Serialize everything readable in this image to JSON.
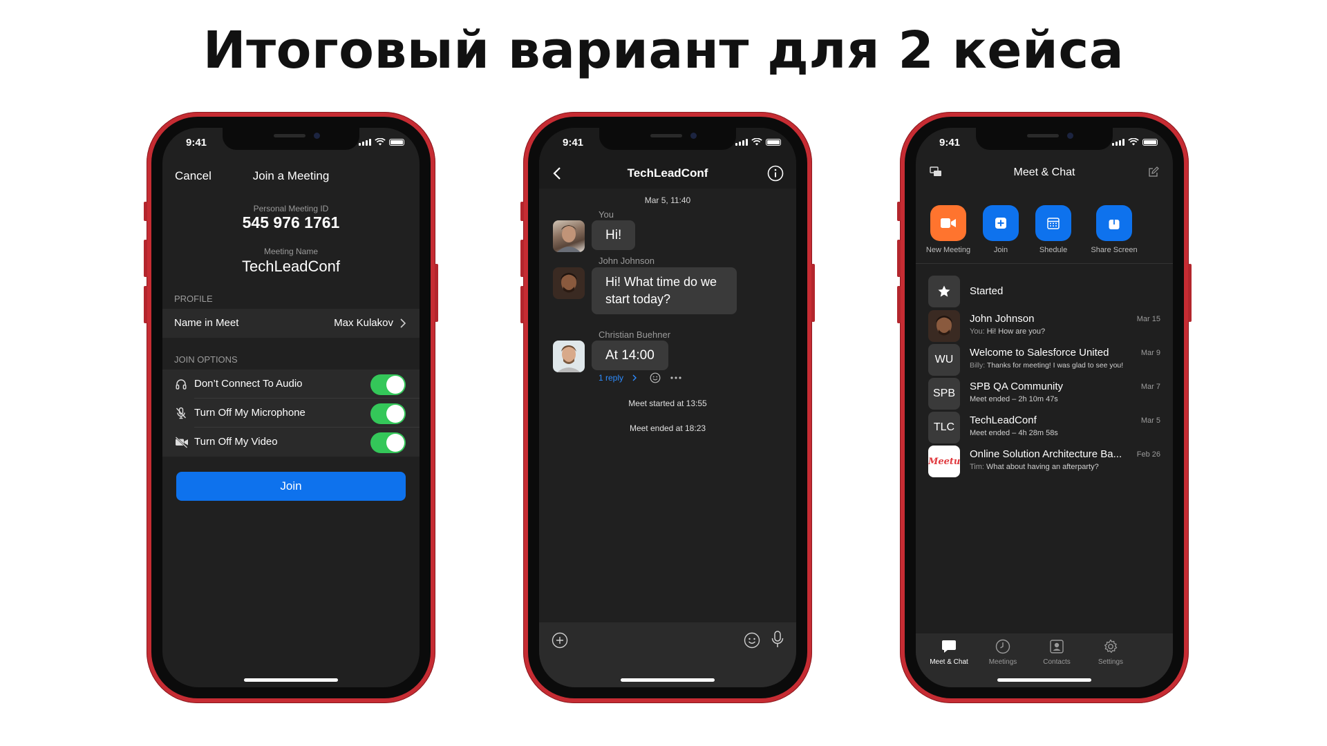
{
  "slide_title": "Итоговый вариант для 2 кейса",
  "status_time": "9:41",
  "join_screen": {
    "cancel": "Cancel",
    "title": "Join a Meeting",
    "pmi_label": "Personal Meeting ID",
    "pmi_value": "545 976 1761",
    "meeting_name_label": "Meeting Name",
    "meeting_name_value": "TechLeadConf",
    "profile_header": "PROFILE",
    "name_in_meet_label": "Name in Meet",
    "name_in_meet_value": "Max Kulakov",
    "join_options_header": "JOIN OPTIONS",
    "options": [
      {
        "label": "Don’t Connect To Audio",
        "icon": "headphones-icon",
        "on": true
      },
      {
        "label": "Turn Off My Microphone",
        "icon": "mic-off-icon",
        "on": true
      },
      {
        "label": "Turn Off My Video",
        "icon": "video-off-icon",
        "on": true
      }
    ],
    "join_button": "Join"
  },
  "chat_screen": {
    "title": "TechLeadConf",
    "date": "Mar 5, 11:40",
    "messages": [
      {
        "sender": "You",
        "text": "Hi!"
      },
      {
        "sender": "John Johnson",
        "text": "Hi! What time do we start today?"
      },
      {
        "sender": "Christian Buehner",
        "text": "At 14:00"
      }
    ],
    "reply_link": "1 reply",
    "system": [
      "Meet started at 13:55",
      "Meet ended at 18:23"
    ]
  },
  "meet_chat_screen": {
    "title": "Meet & Chat",
    "actions": [
      {
        "label": "New Meeting",
        "icon": "video-camera-icon",
        "color": "#ff742e"
      },
      {
        "label": "Join",
        "icon": "plus-icon",
        "color": "#0e72ed"
      },
      {
        "label": "Shedule",
        "icon": "calendar-icon",
        "color": "#0e72ed"
      },
      {
        "label": "Share Screen",
        "icon": "share-up-icon",
        "color": "#0e72ed"
      }
    ],
    "starred_label": "Started",
    "chats": [
      {
        "name": "John Johnson",
        "who": "You:",
        "preview": "Hi! How are you?",
        "date": "Mar 15",
        "avatar": "photo"
      },
      {
        "name": "Welcome to Salesforce United",
        "who": "Billy:",
        "preview": "Thanks for meeting! I was glad to see you!",
        "date": "Mar 9",
        "avatar": "WU"
      },
      {
        "name": "SPB QA Community",
        "who": "",
        "preview": "Meet ended – 2h 10m 47s",
        "date": "Mar 7",
        "avatar": "SPB"
      },
      {
        "name": "TechLeadConf",
        "who": "",
        "preview": "Meet ended – 4h 28m 58s",
        "date": "Mar 5",
        "avatar": "TLC"
      },
      {
        "name": "Online Solution Architecture Ba...",
        "who": "Tim:",
        "preview": "What about having an afterparty?",
        "date": "Feb 26",
        "avatar": "Meetup"
      }
    ],
    "tabs": [
      {
        "label": "Meet & Chat",
        "icon": "chat-bubble-icon",
        "active": true
      },
      {
        "label": "Meetings",
        "icon": "clock-icon",
        "active": false
      },
      {
        "label": "Contacts",
        "icon": "contact-card-icon",
        "active": false
      },
      {
        "label": "Settings",
        "icon": "gear-icon",
        "active": false
      }
    ]
  }
}
